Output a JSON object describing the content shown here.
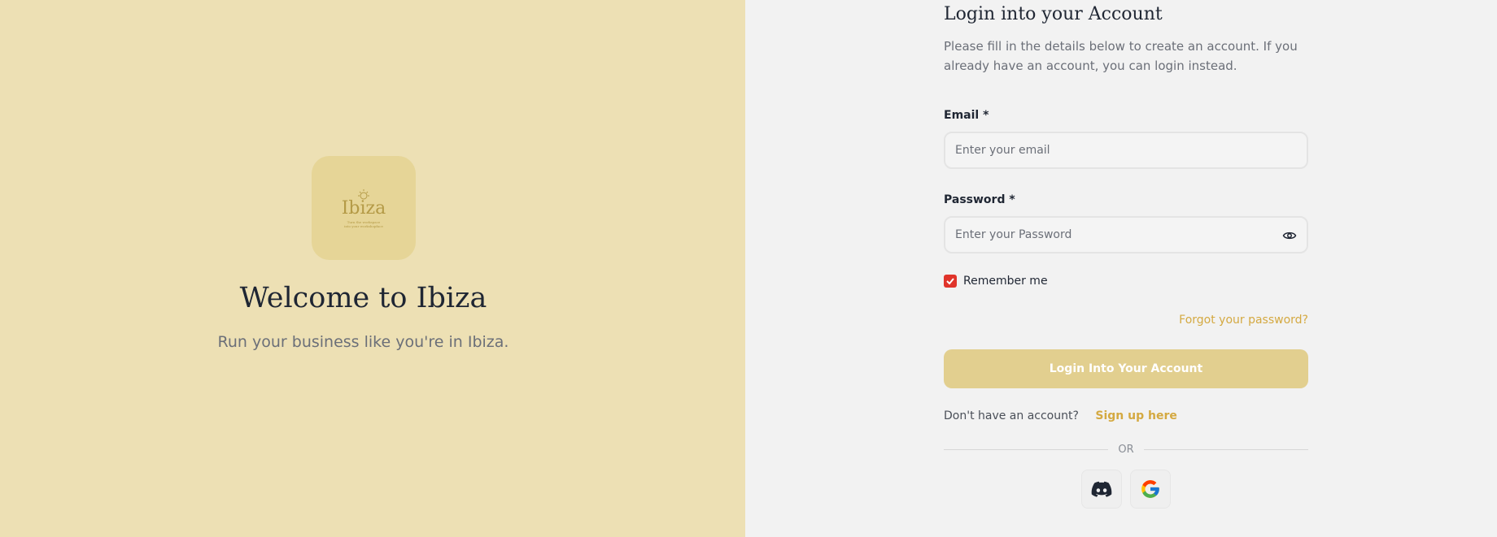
{
  "brand": {
    "logo_word": "Ibiza",
    "logo_tagline": "Turn the workspace into your workshopface",
    "welcome_title": "Welcome to Ibiza",
    "tagline": "Run your business like you're in Ibiza."
  },
  "form": {
    "title": "Login into your Account",
    "description": "Please fill in the details below to create an account. If you already have an account, you can login instead.",
    "email_label": "Email *",
    "email_placeholder": "Enter your email",
    "password_label": "Password *",
    "password_placeholder": "Enter your Password",
    "remember_label": "Remember me",
    "remember_checked": true,
    "forgot_link": "Forgot your password?",
    "login_button": "Login Into Your Account",
    "signup_prompt": "Don't have an account?",
    "signup_link": "Sign up here",
    "divider_text": "OR"
  },
  "social": [
    {
      "icon": "discord-icon"
    },
    {
      "icon": "google-icon"
    }
  ],
  "colors": {
    "left_background": "#ede0b4",
    "logo_tile": "#e6d597",
    "accent": "#d4a941",
    "button": "#e2cf8f",
    "checkbox": "#e0342b",
    "right_background": "#f2f2f2"
  }
}
